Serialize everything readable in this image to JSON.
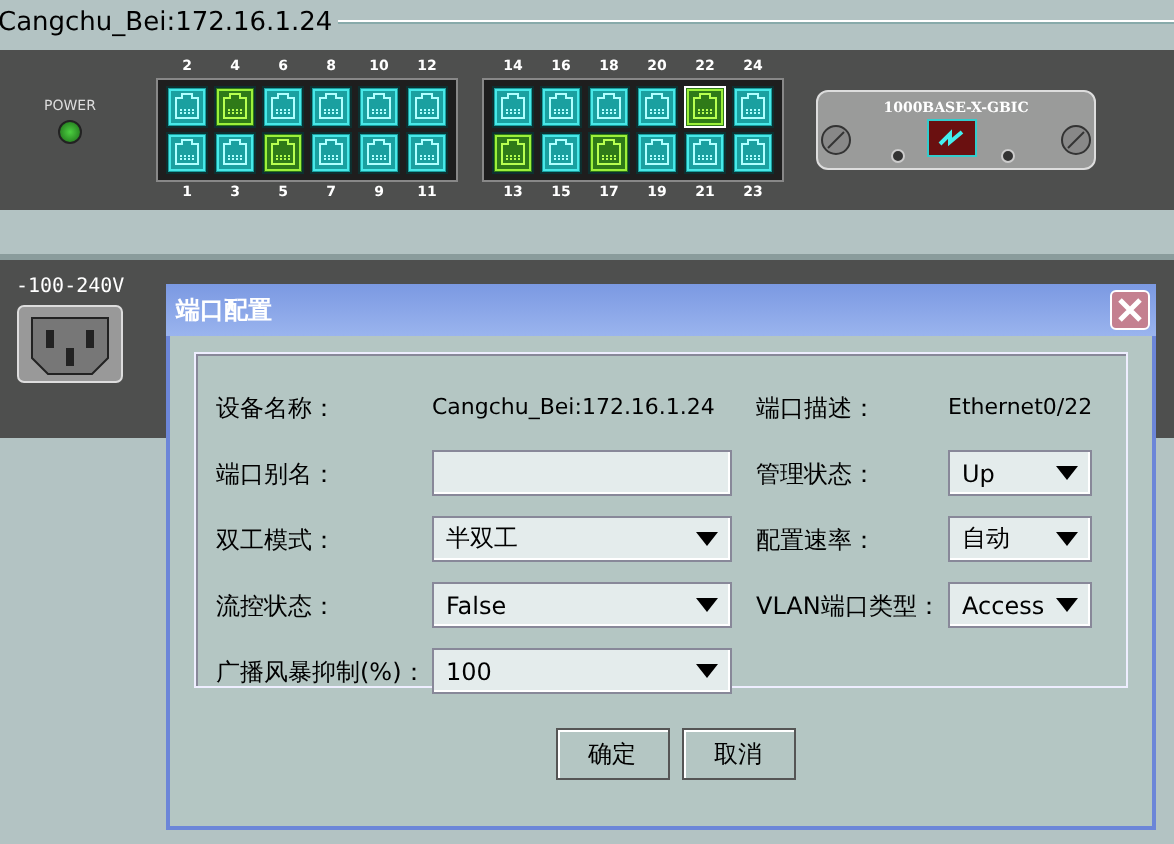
{
  "device_title": "Cangchu_Bei:172.16.1.24",
  "switch": {
    "power_label": "POWER",
    "power_on": true,
    "port_groups": [
      {
        "top": [
          {
            "label": "2",
            "active": false,
            "selected": false
          },
          {
            "label": "4",
            "active": true,
            "selected": false
          },
          {
            "label": "6",
            "active": false,
            "selected": false
          },
          {
            "label": "8",
            "active": false,
            "selected": false
          },
          {
            "label": "10",
            "active": false,
            "selected": false
          },
          {
            "label": "12",
            "active": false,
            "selected": false
          }
        ],
        "bottom": [
          {
            "label": "1",
            "active": false,
            "selected": false
          },
          {
            "label": "3",
            "active": false,
            "selected": false
          },
          {
            "label": "5",
            "active": true,
            "selected": false
          },
          {
            "label": "7",
            "active": false,
            "selected": false
          },
          {
            "label": "9",
            "active": false,
            "selected": false
          },
          {
            "label": "11",
            "active": false,
            "selected": false
          }
        ]
      },
      {
        "top": [
          {
            "label": "14",
            "active": false,
            "selected": false
          },
          {
            "label": "16",
            "active": false,
            "selected": false
          },
          {
            "label": "18",
            "active": false,
            "selected": false
          },
          {
            "label": "20",
            "active": false,
            "selected": false
          },
          {
            "label": "22",
            "active": true,
            "selected": true
          },
          {
            "label": "24",
            "active": false,
            "selected": false
          }
        ],
        "bottom": [
          {
            "label": "13",
            "active": true,
            "selected": false
          },
          {
            "label": "15",
            "active": false,
            "selected": false
          },
          {
            "label": "17",
            "active": true,
            "selected": false
          },
          {
            "label": "19",
            "active": false,
            "selected": false
          },
          {
            "label": "21",
            "active": false,
            "selected": false
          },
          {
            "label": "23",
            "active": false,
            "selected": false
          }
        ]
      }
    ],
    "module": {
      "label": "1000BASE-X-GBIC"
    },
    "voltage_label": "-100-240V"
  },
  "dialog": {
    "title": "端口配置",
    "rows": [
      [
        {
          "label": "设备名称：",
          "kind": "text",
          "value": "Cangchu_Bei:172.16.1.24"
        },
        {
          "label": "端口描述：",
          "kind": "text",
          "value": "Ethernet0/22"
        }
      ],
      [
        {
          "label": "端口别名：",
          "kind": "input"
        },
        {
          "label": "管理状态：",
          "kind": "select",
          "value": "Up"
        }
      ],
      [
        {
          "label": "双工模式：",
          "kind": "select",
          "value": "半双工"
        },
        {
          "label": "配置速率：",
          "kind": "select",
          "value": "自动"
        }
      ],
      [
        {
          "label": "流控状态：",
          "kind": "select",
          "value": "False"
        },
        {
          "label": "VLAN端口类型：",
          "kind": "select",
          "value": "Access"
        }
      ],
      [
        {
          "label": "广播风暴抑制(%)：",
          "kind": "select",
          "value": "100"
        }
      ]
    ],
    "buttons": [
      "确定",
      "取消"
    ]
  }
}
